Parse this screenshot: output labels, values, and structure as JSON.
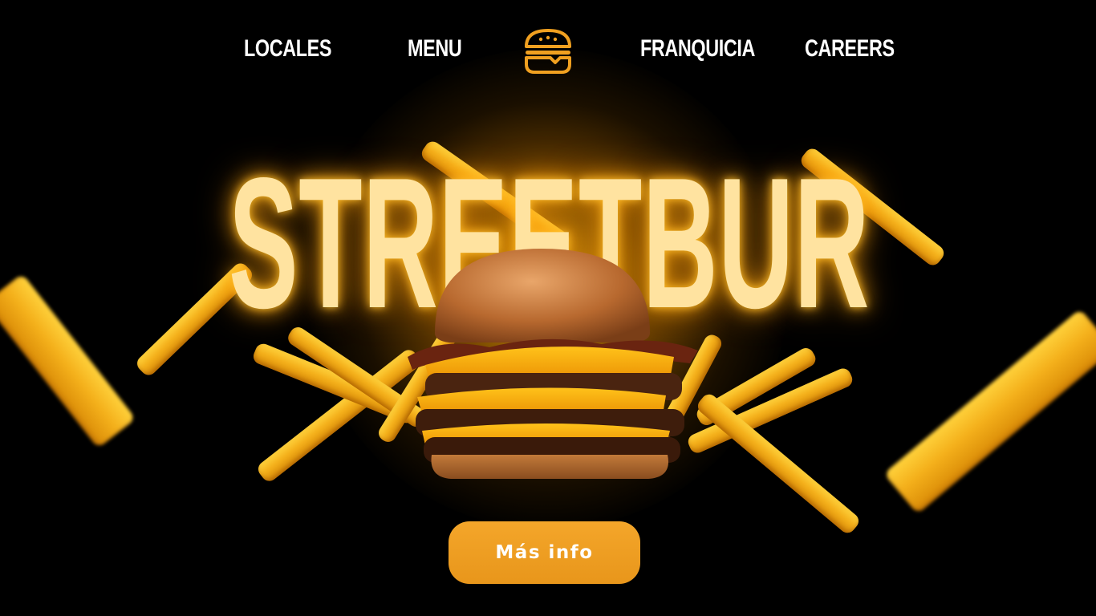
{
  "nav": {
    "items": [
      {
        "label": "LOCALES"
      },
      {
        "label": "MENU"
      },
      {
        "label": "FRANQUICIA"
      },
      {
        "label": "CAREERS"
      }
    ],
    "logo_icon": "burger-icon"
  },
  "hero": {
    "title": "STREETBUR",
    "cta_label": "Más info"
  },
  "colors": {
    "background": "#000000",
    "accent": "#f0a020",
    "title": "#ffe3a0",
    "nav_text": "#ffffff"
  }
}
